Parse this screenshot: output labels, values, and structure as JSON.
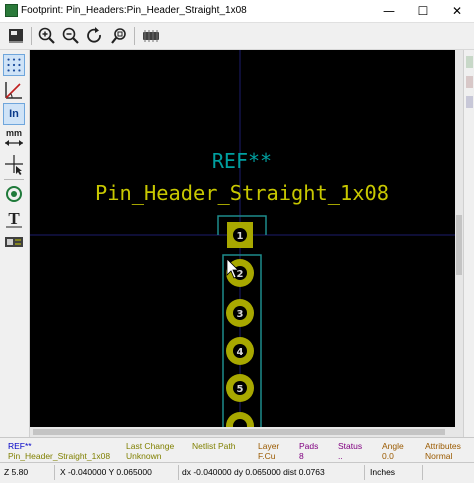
{
  "window": {
    "title": "Footprint: Pin_Headers:Pin_Header_Straight_1x08",
    "minimize": "—",
    "maximize": "☐",
    "close": "✕"
  },
  "canvas": {
    "reference": "REF**",
    "value": "Pin_Header_Straight_1x08",
    "pads": [
      "1",
      "2",
      "3",
      "4",
      "5"
    ],
    "colors": {
      "background": "#000000",
      "reference_text": "#00a0a0",
      "value_text": "#c8c800",
      "pad_copper": "#a8a800",
      "courtyard": "#1e8c8c",
      "grid_axis": "#1c1c6c"
    }
  },
  "left_toolbar": {
    "units_label": "In",
    "mm_label": "mm"
  },
  "message_panel": {
    "columns": [
      {
        "header": "REF**",
        "value": "Pin_Header_Straight_1x08"
      },
      {
        "header": "Last Change",
        "value": "Unknown"
      },
      {
        "header": "Netlist Path",
        "value": ""
      },
      {
        "header": "Layer",
        "value": "F.Cu"
      },
      {
        "header": "Pads",
        "value": "8"
      },
      {
        "header": "Status",
        "value": ".."
      },
      {
        "header": "Angle",
        "value": "0.0"
      },
      {
        "header": "Attributes",
        "value": "Normal"
      }
    ]
  },
  "status_bar": {
    "zoom": "Z 5.80",
    "coords": "X -0.040000  Y 0.065000",
    "delta": "dx -0.040000  dy 0.065000  dist 0.0763",
    "units": "Inches"
  }
}
